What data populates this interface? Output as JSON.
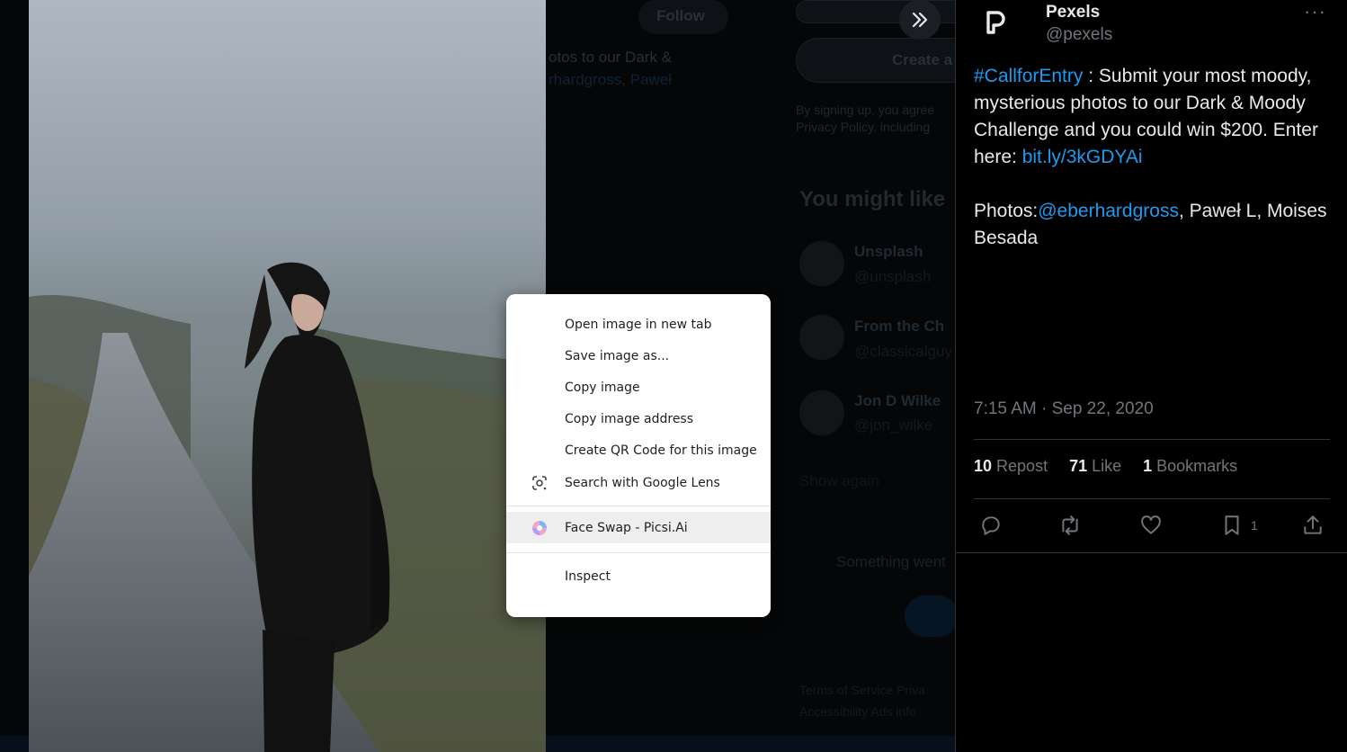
{
  "background": {
    "follow_label": "Follow",
    "snippet_1": "otos to our Dark &",
    "snippet_2": "rhardgross, Paweł",
    "create_label": "Create a",
    "terms_1": "By signing up, you agree",
    "terms_2": "Privacy Policy, including",
    "might_like": "You might like",
    "suggest_1_name": "Unsplash",
    "suggest_1_handle": "@unsplash",
    "suggest_2_name": "From the Ch",
    "suggest_2_handle": "@classicalguy",
    "suggest_3_name": "Jon D Wilke",
    "suggest_3_handle": "@jon_wilke",
    "show_more": "Show again",
    "something_wrong": "Something went",
    "footer_1": "Terms of Service   Priva",
    "footer_2": "Accessibility   Ads info"
  },
  "context_menu": {
    "items": [
      {
        "label": "Open image in new tab"
      },
      {
        "label": "Save image as..."
      },
      {
        "label": "Copy image"
      },
      {
        "label": "Copy image address"
      },
      {
        "label": "Create QR Code for this image"
      },
      {
        "label": "Search with Google Lens"
      },
      {
        "label": "Face Swap - Picsi.Ai"
      },
      {
        "label": "Inspect"
      }
    ]
  },
  "tweet": {
    "author_name": "Pexels",
    "author_handle": "@pexels",
    "more_label": "···",
    "hashtag": "#CallforEntry",
    "text_1": " : Submit your most moody, mysterious photos to our Dark & Moody Challenge and you could win $200. Enter here:  ",
    "link": "bit.ly/3kGDYAi",
    "photos_prefix": "Photos:",
    "mention": "@eberhardgross",
    "photos_suffix": ", Paweł L, Moises Besada",
    "timestamp": "7:15 AM · Sep 22, 2020",
    "reposts_count": "10",
    "reposts_label": "Repost",
    "likes_count": "71",
    "likes_label": "Like",
    "bookmarks_count": "1",
    "bookmarks_label": "Bookmarks",
    "bookmark_action_count": "1"
  },
  "colors": {
    "accent": "#1d9bf0",
    "text_primary": "#e7e9ea",
    "text_secondary": "#71767b"
  }
}
